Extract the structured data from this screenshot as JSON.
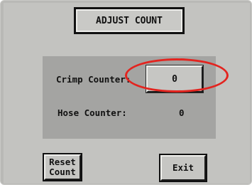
{
  "screen": {
    "title": "ADJUST COUNT"
  },
  "counters": {
    "crimp_label": "Crimp Counter:",
    "crimp_value": "0",
    "hose_label": "Hose Counter:",
    "hose_value": "0"
  },
  "buttons": {
    "reset_label": "Reset\nCount",
    "exit_label": "Exit"
  },
  "colors": {
    "highlight": "#e3241f",
    "screen_background": "#c3c3c0",
    "panel_background": "#a4a4a2"
  }
}
